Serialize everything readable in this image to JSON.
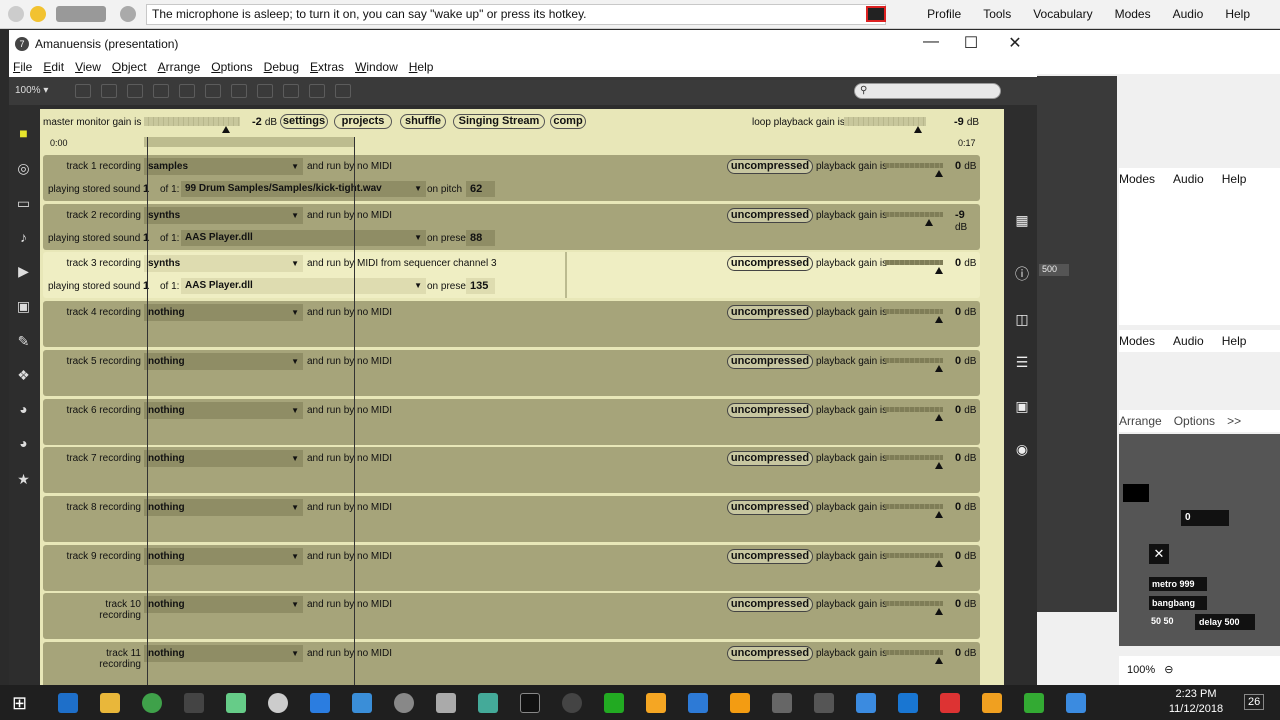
{
  "topbar": {
    "message": "The microphone is asleep; to turn it on, you can say \"wake up\" or press its hotkey.",
    "menu": [
      "Profile",
      "Tools",
      "Vocabulary",
      "Modes",
      "Audio",
      "Help"
    ]
  },
  "window": {
    "title": "Amanuensis (presentation)",
    "menu": [
      "File",
      "Edit",
      "View",
      "Object",
      "Arrange",
      "Options",
      "Debug",
      "Extras",
      "Window",
      "Help"
    ],
    "zoom": "100%"
  },
  "header": {
    "master_label": "master monitor gain is",
    "master_value": "-2",
    "master_unit": "dB",
    "master_level": 0.85,
    "buttons": [
      "settings",
      "projects",
      "shuffle",
      "Singing Stream",
      "comp"
    ],
    "loop_label": "loop playback gain is",
    "loop_value": "-9",
    "loop_unit": "dB",
    "loop_level": 0.9,
    "time_start": "0:00",
    "time_end": "0:17"
  },
  "tracks": [
    {
      "name": "track 1 recording",
      "source": "samples",
      "run": "and run by no MIDI",
      "playing": "playing stored sound",
      "count": "1",
      "of": "of 1:",
      "file": "99 Drum Samples/Samples/kick-tight.wav",
      "param_label": "on pitch",
      "param": "62",
      "compress": "uncompressed",
      "gain_label": "playback gain is",
      "gain": "0",
      "unit": "dB",
      "active": false,
      "has_play": true
    },
    {
      "name": "track 2 recording",
      "source": "synths",
      "run": "and run by no MIDI",
      "playing": "playing stored sound",
      "count": "1",
      "of": "of 1:",
      "file": "AAS Player.dll",
      "param_label": "on preset",
      "param": "88",
      "compress": "uncompressed",
      "gain_label": "playback gain is",
      "gain": "-9",
      "unit": "dB",
      "active": false,
      "has_play": true
    },
    {
      "name": "track 3 recording",
      "source": "synths",
      "run": "and run by MIDI from sequencer channel 3",
      "playing": "playing stored sound",
      "count": "1",
      "of": "of 1:",
      "file": "AAS Player.dll",
      "param_label": "on preset",
      "param": "135",
      "compress": "uncompressed",
      "gain_label": "playback gain is",
      "gain": "0",
      "unit": "dB",
      "active": true,
      "has_play": true
    },
    {
      "name": "track 4 recording",
      "source": "nothing",
      "run": "and run by no MIDI",
      "compress": "uncompressed",
      "gain_label": "playback gain is",
      "gain": "0",
      "unit": "dB",
      "active": false,
      "has_play": false
    },
    {
      "name": "track 5 recording",
      "source": "nothing",
      "run": "and run by no MIDI",
      "compress": "uncompressed",
      "gain_label": "playback gain is",
      "gain": "0",
      "unit": "dB",
      "active": false,
      "has_play": false
    },
    {
      "name": "track 6 recording",
      "source": "nothing",
      "run": "and run by no MIDI",
      "compress": "uncompressed",
      "gain_label": "playback gain is",
      "gain": "0",
      "unit": "dB",
      "active": false,
      "has_play": false
    },
    {
      "name": "track 7 recording",
      "source": "nothing",
      "run": "and run by no MIDI",
      "compress": "uncompressed",
      "gain_label": "playback gain is",
      "gain": "0",
      "unit": "dB",
      "active": false,
      "has_play": false
    },
    {
      "name": "track 8 recording",
      "source": "nothing",
      "run": "and run by no MIDI",
      "compress": "uncompressed",
      "gain_label": "playback gain is",
      "gain": "0",
      "unit": "dB",
      "active": false,
      "has_play": false
    },
    {
      "name": "track 9 recording",
      "source": "nothing",
      "run": "and run by no MIDI",
      "compress": "uncompressed",
      "gain_label": "playback gain is",
      "gain": "0",
      "unit": "dB",
      "active": false,
      "has_play": false
    },
    {
      "name": "track 10 recording",
      "source": "nothing",
      "run": "and run by no MIDI",
      "compress": "uncompressed",
      "gain_label": "playback gain is",
      "gain": "0",
      "unit": "dB",
      "active": false,
      "has_play": false
    },
    {
      "name": "track 11 recording",
      "source": "nothing",
      "run": "and run by no MIDI",
      "compress": "uncompressed",
      "gain_label": "playback gain is",
      "gain": "0",
      "unit": "dB",
      "active": false,
      "has_play": false
    }
  ],
  "right_panel": {
    "menu1": [
      "Modes",
      "Audio",
      "Help"
    ],
    "menu2": [
      "Modes",
      "Audio",
      "Help"
    ],
    "menu3": [
      "Arrange",
      "Options",
      ">>"
    ],
    "val500": "500",
    "zero": "0",
    "metro": "metro 999",
    "bangbang": "bangbang",
    "delay": "delay 500",
    "fifty": "50 50",
    "zoom": "100%"
  },
  "taskbar": {
    "time": "2:23 PM",
    "date": "11/12/2018",
    "badge": "26"
  },
  "colors": {
    "patch_bg": "#e8e7b8",
    "track_bg": "#a6a47a",
    "active_track": "#efeec3",
    "accent": "#d22"
  }
}
